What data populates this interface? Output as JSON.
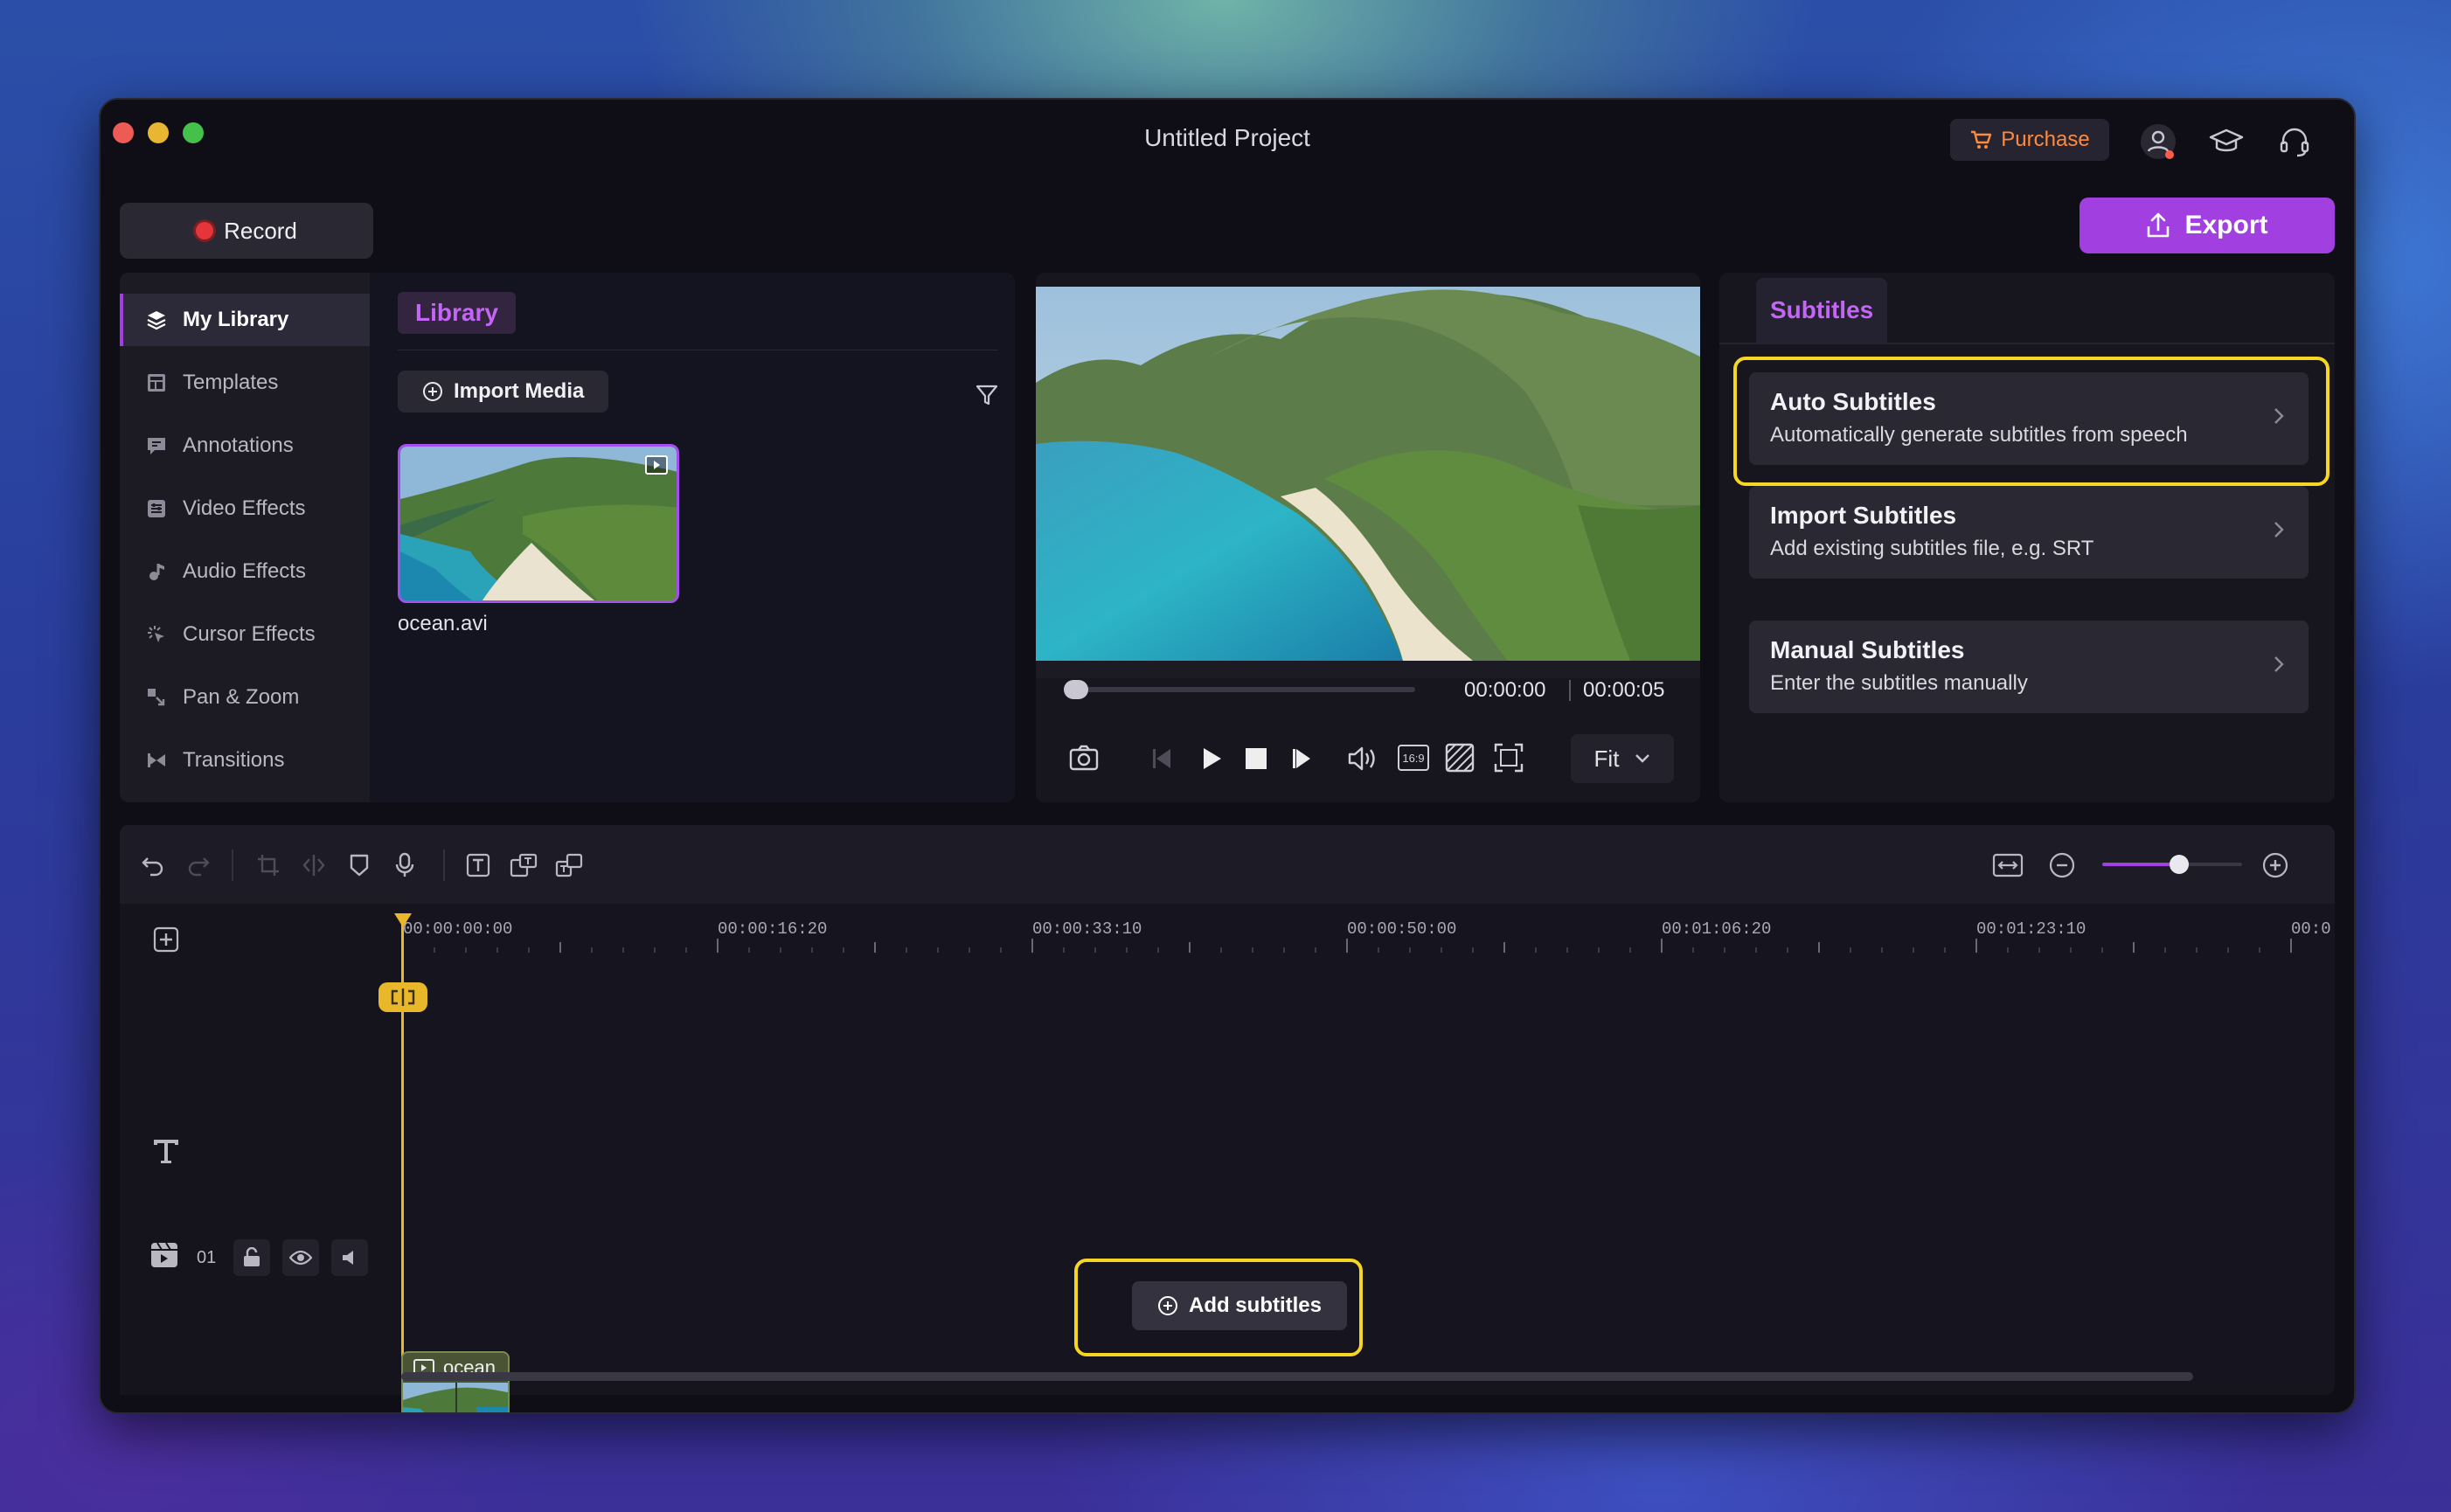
{
  "window": {
    "title": "Untitled Project"
  },
  "header": {
    "purchase_label": "Purchase",
    "icons": [
      "cart-icon",
      "user-icon",
      "graduation-cap-icon",
      "headset-icon"
    ],
    "record_label": "Record",
    "export_label": "Export"
  },
  "sidebar": {
    "items": [
      {
        "label": "My Library",
        "icon": "layers-icon",
        "active": true
      },
      {
        "label": "Templates",
        "icon": "template-icon"
      },
      {
        "label": "Annotations",
        "icon": "annotation-icon"
      },
      {
        "label": "Video Effects",
        "icon": "video-effects-icon"
      },
      {
        "label": "Audio Effects",
        "icon": "music-note-icon"
      },
      {
        "label": "Cursor Effects",
        "icon": "cursor-effects-icon"
      },
      {
        "label": "Pan & Zoom",
        "icon": "pan-zoom-icon"
      },
      {
        "label": "Transitions",
        "icon": "transitions-icon"
      }
    ]
  },
  "library": {
    "tab_label": "Library",
    "import_label": "Import Media",
    "media": [
      {
        "name": "ocean.avi"
      }
    ]
  },
  "preview": {
    "current_time": "00:00:00",
    "total_time": "00:00:05",
    "fit_label": "Fit",
    "aspect_label": "16:9"
  },
  "subtitles": {
    "tab_label": "Subtitles",
    "options": [
      {
        "title": "Auto Subtitles",
        "desc": "Automatically generate subtitles from speech"
      },
      {
        "title": "Import Subtitles",
        "desc": "Add existing subtitles file, e.g. SRT"
      },
      {
        "title": "Manual Subtitles",
        "desc": "Enter the subtitles manually"
      }
    ]
  },
  "timeline": {
    "ruler": [
      "00:00:00:00",
      "00:00:16:20",
      "00:00:33:10",
      "00:00:50:00",
      "00:01:06:20",
      "00:01:23:10",
      "00:0"
    ],
    "add_subtitles_label": "Add subtitles",
    "track_number": "01",
    "clip_name": "ocean",
    "zoom_level": 0.55
  },
  "colors": {
    "accent": "#a23fe0",
    "highlight": "#f6d523",
    "playhead": "#e8b82a",
    "purchase": "#ff8a3d"
  }
}
